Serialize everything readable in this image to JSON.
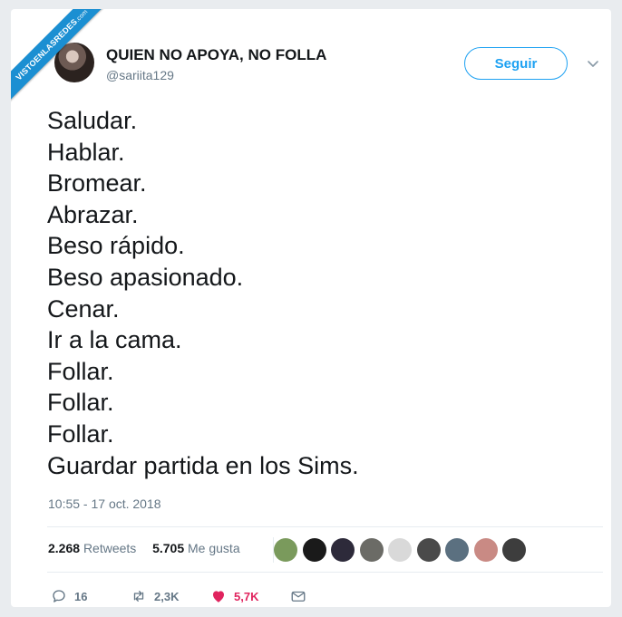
{
  "watermark": {
    "main": "VISTOENLASREDES",
    "suffix": ".com"
  },
  "user": {
    "display_name": "QUIEN NO APOYA, NO FOLLA",
    "handle": "@sariita129"
  },
  "follow_button": {
    "label": "Seguir"
  },
  "tweet": {
    "lines": [
      "Saludar.",
      "Hablar.",
      "Bromear.",
      "Abrazar.",
      "Beso rápido.",
      "Beso apasionado.",
      "Cenar.",
      "Ir a la cama.",
      "Follar.",
      "Follar.",
      "Follar.",
      "Guardar partida en los Sims."
    ],
    "timestamp": "10:55 - 17 oct. 2018"
  },
  "stats": {
    "retweets_count": "2.268",
    "retweets_label": "Retweets",
    "likes_count": "5.705",
    "likes_label": "Me gusta"
  },
  "likers": [
    {
      "color": "#7a9a5c"
    },
    {
      "color": "#1a1a1a"
    },
    {
      "color": "#2d2a3a"
    },
    {
      "color": "#6b6b66"
    },
    {
      "color": "#d9d9d9"
    },
    {
      "color": "#4a4a4a"
    },
    {
      "color": "#5b7080"
    },
    {
      "color": "#c98a84"
    },
    {
      "color": "#3d3d3d"
    }
  ],
  "actions": {
    "replies": "16",
    "retweets": "2,3K",
    "likes": "5,7K"
  },
  "colors": {
    "accent": "#1da1f2",
    "like": "#e0245e",
    "muted": "#657786",
    "ribbon": "#1b8fd2"
  }
}
